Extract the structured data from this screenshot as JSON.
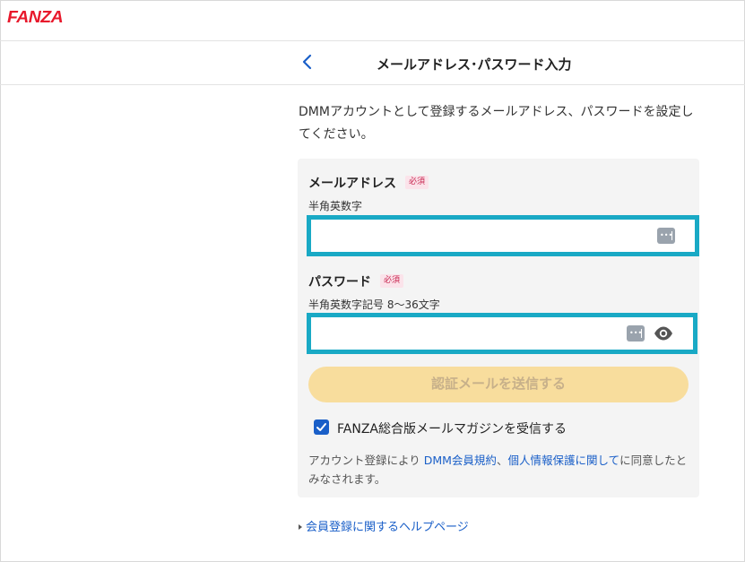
{
  "header": {
    "logo": "FANZA"
  },
  "page": {
    "title": "メールアドレス･パスワード入力",
    "intro": "DMMアカウントとして登録するメールアドレス、パスワードを設定してください。"
  },
  "form": {
    "email": {
      "label": "メールアドレス",
      "required": "必須",
      "hint": "半角英数字",
      "value": "",
      "placeholder": ""
    },
    "password": {
      "label": "パスワード",
      "required": "必須",
      "hint": "半角英数字記号 8～36文字",
      "value": "",
      "placeholder": ""
    },
    "submit_label": "認証メールを送信する",
    "newsletter": {
      "label": "FANZA総合版メールマガジンを受信する",
      "checked": true
    },
    "terms": {
      "prefix": "アカウント登録により ",
      "link1": "DMM会員規約",
      "sep": "、",
      "link2": "個人情報保護に関して",
      "suffix": "に同意したとみなされます。"
    }
  },
  "footer": {
    "help_link": "会員登録に関するヘルプページ"
  },
  "icons": {
    "back": "chevron-left-icon",
    "password_manager": "password-manager-icon",
    "show_password": "eye-icon",
    "checkbox": "checkmark-icon",
    "bullet": "triangle-right-icon"
  },
  "colors": {
    "brand": "#e8192c",
    "link": "#1a5fc8",
    "focus_border": "#19a9c5",
    "button_disabled_bg": "#f8dd9d",
    "required_badge": "#c7234e"
  }
}
